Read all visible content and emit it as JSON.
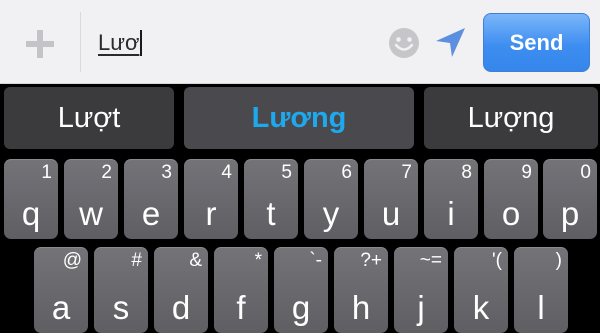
{
  "compose": {
    "add_icon": "plus-icon",
    "input_value": "Lươ",
    "emoji_icon": "smiley-icon",
    "location_icon": "location-arrow-icon",
    "send_label": "Send",
    "send_color": "#3e8ef0"
  },
  "suggestions": [
    {
      "label": "Lượt"
    },
    {
      "label": "Lương"
    },
    {
      "label": "Lượng"
    }
  ],
  "suggestion_highlight_color": "#1ea9ef",
  "keyboard": {
    "row1": [
      {
        "main": "q",
        "hint": "1"
      },
      {
        "main": "w",
        "hint": "2"
      },
      {
        "main": "e",
        "hint": "3"
      },
      {
        "main": "r",
        "hint": "4"
      },
      {
        "main": "t",
        "hint": "5"
      },
      {
        "main": "y",
        "hint": "6"
      },
      {
        "main": "u",
        "hint": "7"
      },
      {
        "main": "i",
        "hint": "8"
      },
      {
        "main": "o",
        "hint": "9"
      },
      {
        "main": "p",
        "hint": "0"
      }
    ],
    "row2": [
      {
        "main": "a",
        "hint": "@"
      },
      {
        "main": "s",
        "hint": "#"
      },
      {
        "main": "d",
        "hint": "&"
      },
      {
        "main": "f",
        "hint": "*"
      },
      {
        "main": "g",
        "hint": "`-"
      },
      {
        "main": "h",
        "hint": "?+"
      },
      {
        "main": "j",
        "hint": "~="
      },
      {
        "main": "k",
        "hint": "'("
      },
      {
        "main": "l",
        "hint": ")"
      }
    ]
  }
}
